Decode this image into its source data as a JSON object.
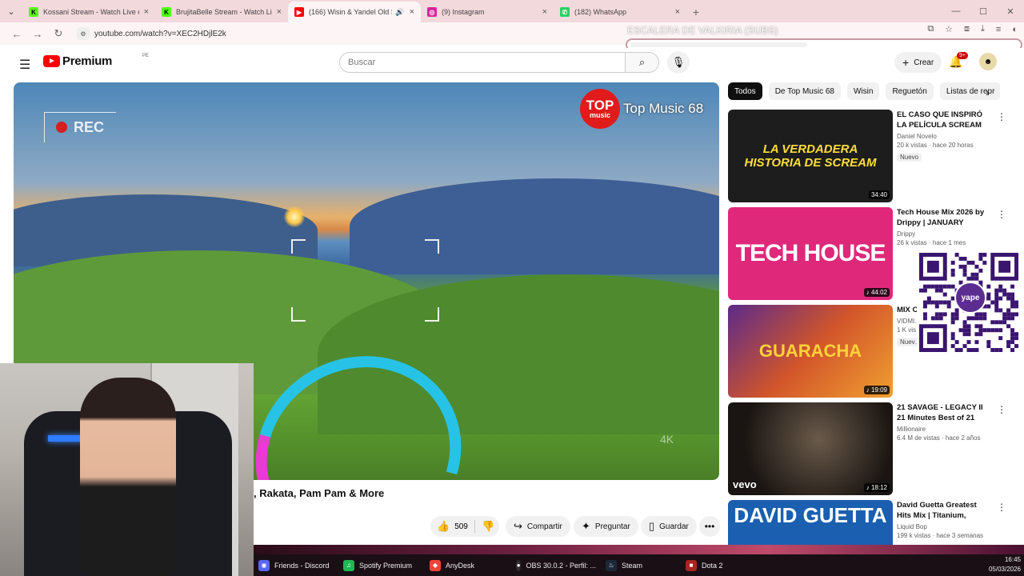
{
  "browser": {
    "tabs": [
      {
        "title": "Kossani Stream - Watch Live o",
        "favicon": "K",
        "color": "#53fc18"
      },
      {
        "title": "BrujitaBelle Stream - Watch Liv",
        "favicon": "K",
        "color": "#53fc18"
      },
      {
        "title": "(166) Wisin & Yandel Old S",
        "favicon": "▶",
        "color": "#ff0000",
        "active": true
      },
      {
        "title": "(9) Instagram",
        "favicon": "◎",
        "color": "#d6249f"
      },
      {
        "title": "(182) WhatsApp",
        "favicon": "✆",
        "color": "#25d366"
      }
    ],
    "new_tab": "+",
    "url": "youtube.com/watch?v=XEC2HDjlE2k"
  },
  "overlay": {
    "title": "ESCALERA DE VALKIRIA (SUBS)",
    "progress": 0.46
  },
  "youtube": {
    "logo_word": "Premium",
    "country": "PE",
    "search_placeholder": "Buscar",
    "create_label": "Crear",
    "notif_count": "9+"
  },
  "video": {
    "rec_label": "REC",
    "brand_t1": "TOP",
    "brand_t2": "music",
    "brand_channel": "Top Music 68",
    "quality": "4K",
    "title_visible": ", Rakata, Pam Pam & More",
    "likes": "509",
    "share": "Compartir",
    "ask": "Preguntar",
    "save": "Guardar"
  },
  "chips": [
    "Todos",
    "De Top Music 68",
    "Wisin",
    "Reguetón",
    "Listas de repr"
  ],
  "recommendations": [
    {
      "title": "EL CASO QUE INSPIRÓ LA PELÍCULA SCREAM 🔪",
      "channel": "Daniel Novelo",
      "views": "20 k vistas · hace 20 horas",
      "badge": "Nuevo",
      "duration": "34:40",
      "thumb_text": "LA VERDADERA HISTORIA DE SCREAM",
      "thumb_color": "#1d1d1d"
    },
    {
      "title": "Tech House Mix 2026 by Drippy | JANUARY EDITIO…",
      "channel": "Drippy",
      "views": "26 k vistas · hace 1 mes",
      "badge": "",
      "duration": "♪ 44:02",
      "thumb_text": "TECH HOUSE",
      "thumb_color": "#e0287a"
    },
    {
      "title": "MIX C… Lo M…",
      "channel": "VIDMI…",
      "views": "1 K vis…",
      "badge": "Nuev…",
      "duration": "♪ 19:09",
      "thumb_text": "GUARACHA",
      "thumb_color": "#c24a2a"
    },
    {
      "title": "21 SAVAGE - LEGACY II 21 Minutes Best of 21 Savag…",
      "channel": "Millionaire",
      "views": "6.4 M de vistas · hace 2 años",
      "badge": "",
      "duration": "♪ 18:12",
      "thumb_text": "vevo",
      "thumb_color": "#2a2420"
    },
    {
      "title": "David Guetta Greatest Hits Mix | Titanium, Memories, …",
      "channel": "Liquid Bop",
      "views": "199 k vistas · hace 3 semanas",
      "badge": "",
      "duration": "",
      "thumb_text": "DAVID GUETTA",
      "thumb_color": "#1a5fb0"
    }
  ],
  "qr_label": "yape",
  "taskbar": [
    {
      "label": "Friends - Discord",
      "color": "#5865f2",
      "icon": "◉"
    },
    {
      "label": "Spotify Premium",
      "color": "#1db954",
      "icon": "♫"
    },
    {
      "label": "AnyDesk",
      "color": "#ef443b",
      "icon": "◆"
    },
    {
      "label": "OBS 30.0.2 - Perfil: ...",
      "color": "#302e31",
      "icon": "●"
    },
    {
      "label": "Steam",
      "color": "#1b2838",
      "icon": "♨"
    },
    {
      "label": "Dota 2",
      "color": "#a7251f",
      "icon": "■"
    }
  ],
  "clock": {
    "time": "16:45",
    "date": "05/03/2026"
  }
}
